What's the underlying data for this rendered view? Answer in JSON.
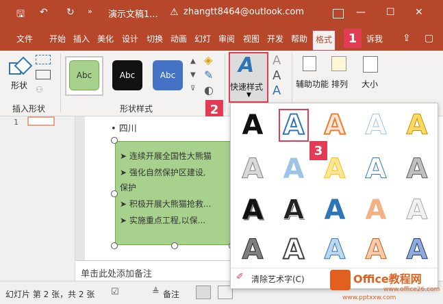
{
  "titlebar": {
    "filename": "演示文稿1...",
    "user": "zhangtt8464@outlook.com"
  },
  "tabs": [
    "文件",
    "开始",
    "插入",
    "美化",
    "设计",
    "切换",
    "动画",
    "幻灯",
    "审阅",
    "视图",
    "开发",
    "帮助",
    "格式",
    "诉我"
  ],
  "ribbon": {
    "insert_shapes": {
      "label": "形状",
      "group": "插入形状"
    },
    "shape_styles": {
      "samples": [
        "Abc",
        "Abc",
        "Abc"
      ],
      "group": "形状样式"
    },
    "quick_styles": "快速样式",
    "arrange_help": "辅助功能",
    "arrange": "排列",
    "size": "大小"
  },
  "badges": [
    "1",
    "2",
    "3"
  ],
  "slide": {
    "bullets": [
      "• 四川",
      "➤ 连续开展全国性大熊猫",
      "➤ 强化自然保护区建设,",
      "  保护",
      "➤ 积极开展大熊猫抢救...",
      "➤ 实施重点工程,以保..."
    ]
  },
  "thumbnail": {
    "number": "1"
  },
  "notes_placeholder": "单击此处添加备注",
  "gallery": {
    "clear": "清除艺术字(C)"
  },
  "status": {
    "slide_info": "幻灯片 第 2 张，共 2 张",
    "notes": "备注"
  },
  "watermark": {
    "brand": "Office教程网",
    "url": "www.pptxxw.com",
    "site": "www.office26.com"
  }
}
